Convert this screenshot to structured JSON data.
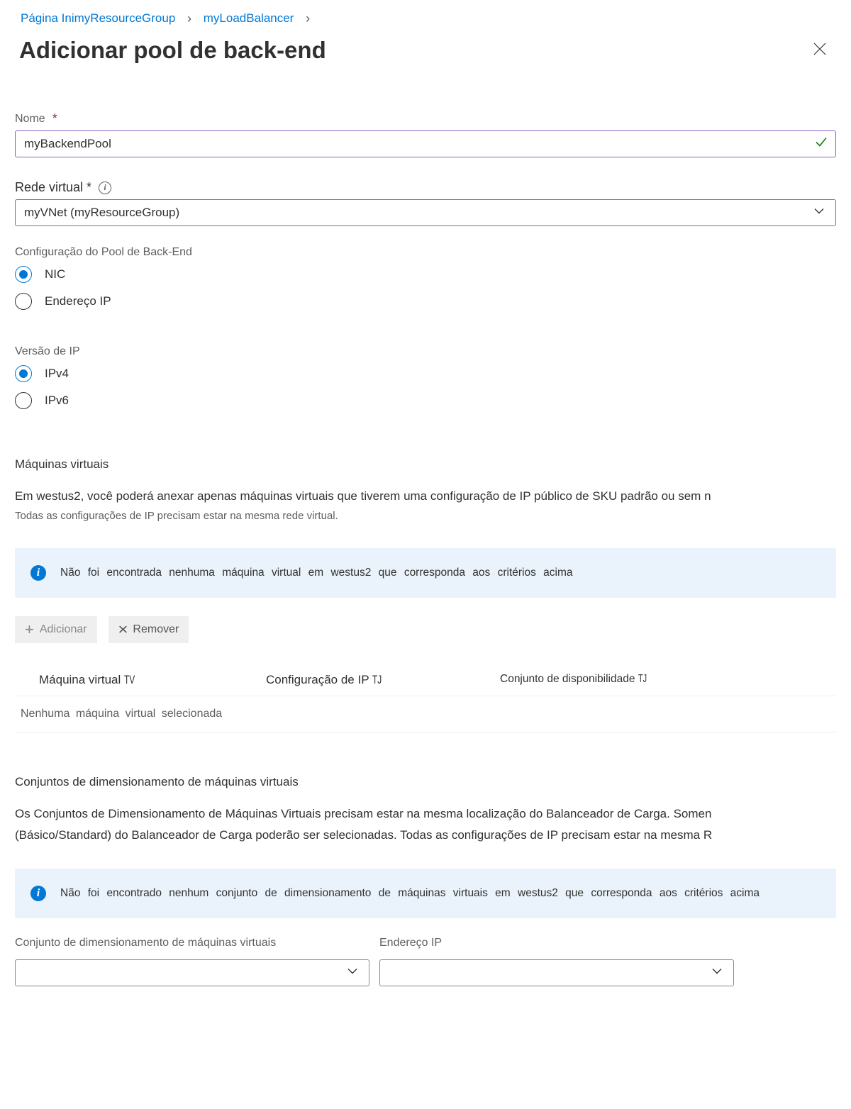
{
  "breadcrumb": {
    "first_a": "Página Ini",
    "first_b": "myResourceGroup",
    "second": "myLoadBalancer"
  },
  "page_title": "Adicionar pool de back-end",
  "form": {
    "name_label": "Nome",
    "name_value": "myBackendPool",
    "vnet_label": "Rede virtual *",
    "vnet_value": "myVNet (myResourceGroup)",
    "poolcfg_label": "Configuração do Pool de Back-End",
    "poolcfg_opt_nic": "NIC",
    "poolcfg_opt_ip": "Endereço IP",
    "ipver_label": "Versão de IP",
    "ipver_v4": "IPv4",
    "ipver_v6": "IPv6"
  },
  "vms": {
    "title": "Máquinas virtuais",
    "desc1": "Em westus2, você poderá anexar apenas máquinas virtuais que tiverem uma configuração de IP público de SKU padrão ou sem n",
    "desc2": "Todas as configurações de IP precisam estar na mesma rede virtual.",
    "notice": "Não foi encontrada nenhuma máquina virtual em westus2 que corresponda aos critérios acima",
    "btn_add": "Adicionar",
    "btn_remove": "Remover",
    "col1": "Máquina virtual",
    "col1_suffix": "TV",
    "col2": "Configuração de IP",
    "col2_suffix": "TJ",
    "col3": "Conjunto de disponibilidade",
    "col3_suffix": "TJ",
    "empty": "Nenhuma máquina virtual selecionada"
  },
  "vmss": {
    "title": "Conjuntos de dimensionamento de máquinas virtuais",
    "desc1": "Os Conjuntos de Dimensionamento de Máquinas Virtuais precisam estar na mesma localização do Balanceador de Carga. Somen",
    "desc2": "(Básico/Standard) do Balanceador de Carga poderão ser selecionadas. Todas as configurações de IP precisam estar na mesma R",
    "notice": "Não foi encontrado nenhum conjunto de dimensionamento de máquinas virtuais em westus2 que corresponda aos critérios acima",
    "col1": "Conjunto de dimensionamento de máquinas virtuais",
    "col2": "Endereço IP"
  }
}
